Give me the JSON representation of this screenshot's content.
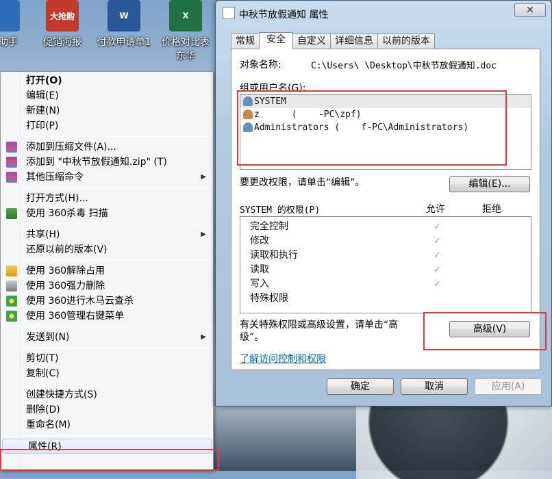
{
  "desktop": {
    "icons": [
      {
        "label": "跟助手",
        "color": "#2c6fb8",
        "glyph": ""
      },
      {
        "label": "促销海报",
        "color": "#c1392b",
        "glyph": "大抢购"
      },
      {
        "label": "付款申请单1",
        "color": "#2b5797",
        "glyph": "W"
      },
      {
        "label": "价格对比表\n东华",
        "color": "#207245",
        "glyph": "X"
      }
    ]
  },
  "context_menu": {
    "items": [
      {
        "type": "item",
        "label": "打开(O)",
        "bold": true
      },
      {
        "type": "item",
        "label": "编辑(E)"
      },
      {
        "type": "item",
        "label": "新建(N)"
      },
      {
        "type": "item",
        "label": "打印(P)"
      },
      {
        "type": "sep"
      },
      {
        "type": "item",
        "label": "添加到压缩文件(A)...",
        "icon": "winrar-icon"
      },
      {
        "type": "item",
        "label": "添加到 \"中秋节放假通知.zip\" (T)",
        "icon": "winrar-icon"
      },
      {
        "type": "item",
        "label": "其他压缩命令",
        "icon": "winrar-icon",
        "submenu": true
      },
      {
        "type": "sep"
      },
      {
        "type": "item",
        "label": "打开方式(H)..."
      },
      {
        "type": "item",
        "label": "使用 360杀毒 扫描",
        "icon": "shield-icon"
      },
      {
        "type": "sep"
      },
      {
        "type": "item",
        "label": "共享(H)",
        "submenu": true
      },
      {
        "type": "item",
        "label": "还原以前的版本(V)"
      },
      {
        "type": "sep"
      },
      {
        "type": "item",
        "label": "使用 360解除占用",
        "icon": "unlock-icon"
      },
      {
        "type": "item",
        "label": "使用 360强力删除",
        "icon": "shredder-icon"
      },
      {
        "type": "item",
        "label": "使用 360进行木马云查杀",
        "icon": "360-icon"
      },
      {
        "type": "item",
        "label": "使用 360管理右键菜单",
        "icon": "360-icon"
      },
      {
        "type": "sep"
      },
      {
        "type": "item",
        "label": "发送到(N)",
        "submenu": true
      },
      {
        "type": "sep"
      },
      {
        "type": "item",
        "label": "剪切(T)"
      },
      {
        "type": "item",
        "label": "复制(C)"
      },
      {
        "type": "sep"
      },
      {
        "type": "item",
        "label": "创建快捷方式(S)"
      },
      {
        "type": "item",
        "label": "删除(D)"
      },
      {
        "type": "item",
        "label": "重命名(M)"
      },
      {
        "type": "sep"
      },
      {
        "type": "item",
        "label": "属性(R)",
        "highlight": true
      }
    ]
  },
  "dialog": {
    "title": "中秋节放假通知 属性",
    "close_label": "✕",
    "tabs": [
      "常规",
      "安全",
      "自定义",
      "详细信息",
      "以前的版本"
    ],
    "active_tab": 1,
    "object_name_label": "对象名称:",
    "object_name_value": "C:\\Users\\    \\Desktop\\中秋节放假通知.doc",
    "group_label": "组或用户名(G):",
    "users": [
      "SYSTEM",
      "z      (    -PC\\zpf)",
      "Administrators (    f-PC\\Administrators)"
    ],
    "change_hint": "要更改权限，请单击“编辑”。",
    "edit_button": "编辑(E)...",
    "perm_header": "SYSTEM 的权限(P)",
    "allow_header": "允许",
    "deny_header": "拒绝",
    "permissions": [
      {
        "name": "完全控制",
        "allow": true
      },
      {
        "name": "修改",
        "allow": true
      },
      {
        "name": "读取和执行",
        "allow": true
      },
      {
        "name": "读取",
        "allow": true
      },
      {
        "name": "写入",
        "allow": true
      },
      {
        "name": "特殊权限",
        "allow": false
      }
    ],
    "advanced_hint": "有关特殊权限或高级设置，请单击“高级”。",
    "advanced_button": "高级(V)",
    "learn_link": "了解访问控制和权限",
    "ok_button": "确定",
    "cancel_button": "取消",
    "apply_button": "应用(A)",
    "check_glyph": "✓"
  }
}
